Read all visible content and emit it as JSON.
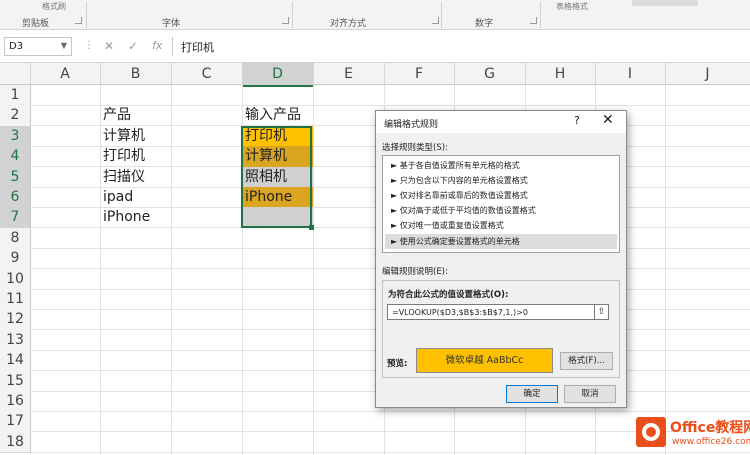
{
  "ribbon": {
    "top_fragments": [
      "格式刷",
      "表格格式"
    ],
    "groups": [
      "剪贴板",
      "字体",
      "对齐方式",
      "数字"
    ]
  },
  "formula_bar": {
    "name_box": "D3",
    "cancel_icon": "✕",
    "enter_icon": "✓",
    "fx_label": "fx",
    "formula": "打印机"
  },
  "grid": {
    "columns": [
      "A",
      "B",
      "C",
      "D",
      "E",
      "F",
      "G",
      "H",
      "I",
      "J"
    ],
    "rows": [
      "1",
      "2",
      "3",
      "4",
      "5",
      "6",
      "7",
      "8",
      "9",
      "10",
      "11",
      "12",
      "13",
      "14",
      "15",
      "16",
      "17",
      "18"
    ],
    "selected_column": "D",
    "product_header": "产品",
    "products": [
      "计算机",
      "打印机",
      "扫描仪",
      "ipad",
      "iPhone"
    ],
    "input_header": "输入产品",
    "inputs": [
      "打印机",
      "计算机",
      "照相机",
      "iPhone"
    ],
    "highlight_colors": {
      "gold": "#ffc000",
      "dark_gold": "#daa520",
      "gray": "#d0d0d0",
      "selection": "#217346"
    }
  },
  "dialog": {
    "title": "编辑格式规则",
    "help": "?",
    "close": "✕",
    "select_type_label": "选择规则类型(S):",
    "rule_types": [
      "► 基于各自值设置所有单元格的格式",
      "► 只为包含以下内容的单元格设置格式",
      "► 仅对排名靠前或靠后的数值设置格式",
      "► 仅对高于或低于平均值的数值设置格式",
      "► 仅对唯一值或重复值设置格式",
      "► 使用公式确定要设置格式的单元格"
    ],
    "edit_desc_label": "编辑规则说明(E):",
    "formula_label": "为符合此公式的值设置格式(O):",
    "formula_value": "=VLOOKUP($D3,$B$3:$B$7,1,)>0",
    "preview_label": "预览:",
    "preview_text": "微软卓越  AaBbCc",
    "preview_color": "#ffc000",
    "format_button": "格式(F)...",
    "ok_button": "确定",
    "cancel_button": "取消"
  },
  "watermark": {
    "line1": "Office教程网",
    "line2": "www.office26.com"
  }
}
